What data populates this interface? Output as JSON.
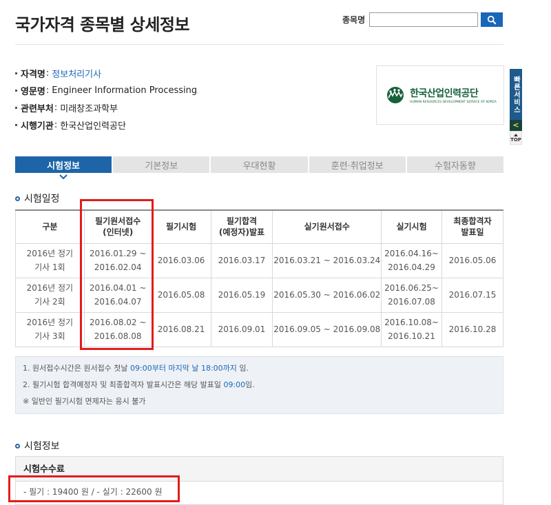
{
  "header": {
    "title": "국가자격 종목별 상세정보",
    "search_label": "종목명",
    "search_value": ""
  },
  "info": {
    "rows": [
      {
        "key": "자격명",
        "value": "정보처리기사",
        "link": true
      },
      {
        "key": "영문명",
        "value": "Engineer Information Processing",
        "link": false
      },
      {
        "key": "관련부처",
        "value": "미래창조과학부",
        "link": false
      },
      {
        "key": "시행기관",
        "value": "한국산업인력공단",
        "link": false
      }
    ],
    "sep": ":"
  },
  "logo": {
    "text": "한국산업인력공단",
    "sub": "HUMAN RESOURCES DEVELOPMENT SERVICE OF KOREA"
  },
  "quick_menu": {
    "label": "빠른서비스",
    "arrow": "<",
    "top": "TOP"
  },
  "tabs": [
    "시험정보",
    "기본정보",
    "우대현황",
    "훈련·취업정보",
    "수험자동향"
  ],
  "schedule": {
    "title": "시험일정",
    "headers": [
      [
        "구분"
      ],
      [
        "필기원서접수",
        "(인터넷)"
      ],
      [
        "필기시험"
      ],
      [
        "필기합격",
        "(예정자)발표"
      ],
      [
        "실기원서접수"
      ],
      [
        "실기시험"
      ],
      [
        "최종합격자",
        "발표일"
      ]
    ],
    "rows": [
      [
        [
          "2016년 정기",
          "기사 1회"
        ],
        [
          "2016.01.29 ~",
          "2016.02.04"
        ],
        [
          "2016.03.06"
        ],
        [
          "2016.03.17"
        ],
        [
          "2016.03.21 ~ 2016.03.24"
        ],
        [
          "2016.04.16~",
          "2016.04.29"
        ],
        [
          "2016.05.06"
        ]
      ],
      [
        [
          "2016년 정기",
          "기사 2회"
        ],
        [
          "2016.04.01 ~",
          "2016.04.07"
        ],
        [
          "2016.05.08"
        ],
        [
          "2016.05.19"
        ],
        [
          "2016.05.30 ~ 2016.06.02"
        ],
        [
          "2016.06.25~",
          "2016.07.08"
        ],
        [
          "2016.07.15"
        ]
      ],
      [
        [
          "2016년 정기",
          "기사 3회"
        ],
        [
          "2016.08.02 ~",
          "2016.08.08"
        ],
        [
          "2016.08.21"
        ],
        [
          "2016.09.01"
        ],
        [
          "2016.09.05 ~ 2016.09.08"
        ],
        [
          "2016.10.08~",
          "2016.10.21"
        ],
        [
          "2016.10.28"
        ]
      ]
    ]
  },
  "notes": {
    "n1_a": "1. 원서접수시간은 원서접수 첫날 ",
    "n1_b": "09:00부터 마지막 날 18:00까지",
    "n1_c": " 임.",
    "n2_a": "2. 필기시험 합격예정자 및 최종합격자 발표시간은 해당 발표일 ",
    "n2_b": "09:00",
    "n2_c": "임.",
    "n3": "※ 일반인 필기시험 면제자는 응시 불가"
  },
  "exam_info": {
    "title": "시험정보",
    "fee_title": "시험수수료",
    "fee_text": "- 필기 : 19400 원 / - 실기 : 22600 원"
  },
  "colors": {
    "accent": "#1d65a8",
    "highlight": "#e21b1b"
  }
}
